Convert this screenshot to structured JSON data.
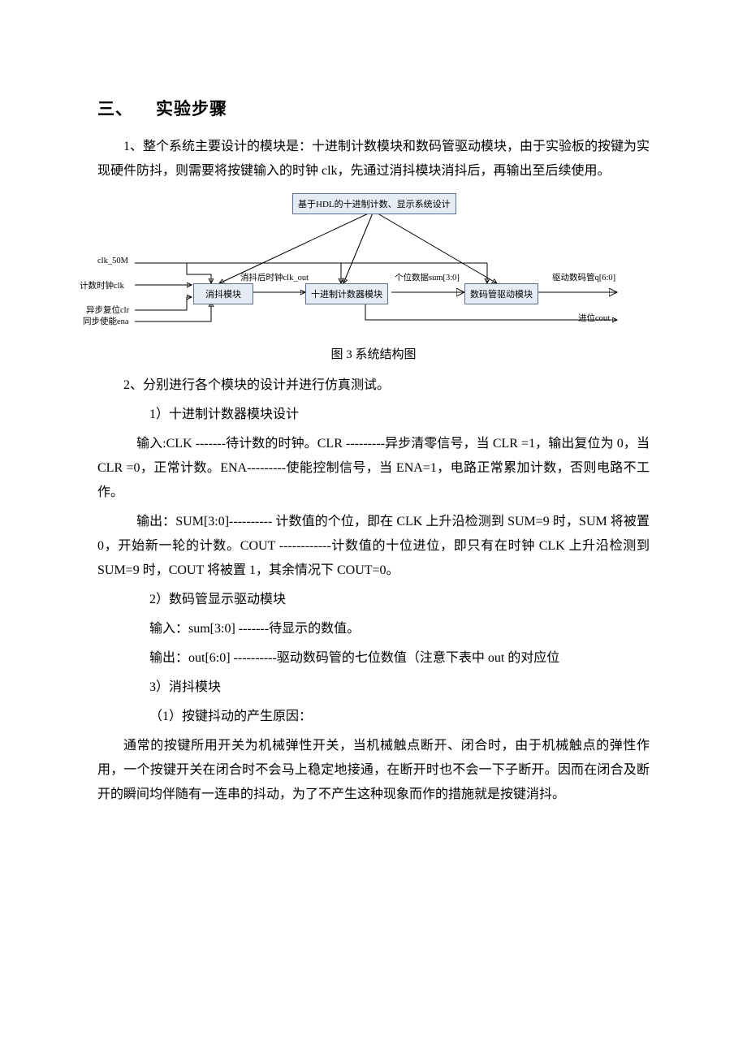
{
  "heading": {
    "num": "三、",
    "title": "实验步骤"
  },
  "p1": "1、整个系统主要设计的模块是：十进制计数模块和数码管驱动模块，由于实验板的按键为实现硬件防抖，则需要将按键输入的时钟 clk，先通过消抖模块消抖后，再输出至后续使用。",
  "diagram": {
    "top_box": "基于HDL的十进制计数、显示系统设计",
    "bx_debounce": "消抖模块",
    "bx_counter": "十进制计数器模块",
    "bx_driver": "数码管驱动模块",
    "in_clk50m": "clk_50M",
    "in_clk": "计数时钟clk",
    "in_clr": "异步复位clr",
    "in_ena": "同步使能ena",
    "sig_clkout": "消抖后时钟clk_out",
    "sig_sum": "个位数据sum[3:0]",
    "out_q": "驱动数码管q[6:0]",
    "out_cout": "进位cout"
  },
  "fig_caption": "图 3   系统结构图",
  "p2": "2、分别进行各个模块的设计并进行仿真测试。",
  "p3": "1）十进制计数器模块设计",
  "p4": "输入:CLK -------待计数的时钟。CLR ---------异步清零信号，当 CLR =1，输出复位为 0，当 CLR =0，正常计数。ENA---------使能控制信号，当 ENA=1，电路正常累加计数，否则电路不工作。",
  "p5": "输出：SUM[3:0]---------- 计数值的个位，即在 CLK 上升沿检测到 SUM=9 时，SUM 将被置 0，开始新一轮的计数。COUT ------------计数值的十位进位，即只有在时钟 CLK 上升沿检测到 SUM=9 时，COUT 将被置 1，其余情况下 COUT=0。",
  "p6": "2）数码管显示驱动模块",
  "p7": "输入：sum[3:0] -------待显示的数值。",
  "p8": "输出：out[6:0] ----------驱动数码管的七位数值（注意下表中 out 的对应位",
  "p9": "3）消抖模块",
  "p10": "（1）按键抖动的产生原因：",
  "p11": "通常的按键所用开关为机械弹性开关，当机械触点断开、闭合时，由于机械触点的弹性作用，一个按键开关在闭合时不会马上稳定地接通，在断开时也不会一下子断开。因而在闭合及断开的瞬间均伴随有一连串的抖动，为了不产生这种现象而作的措施就是按键消抖。"
}
